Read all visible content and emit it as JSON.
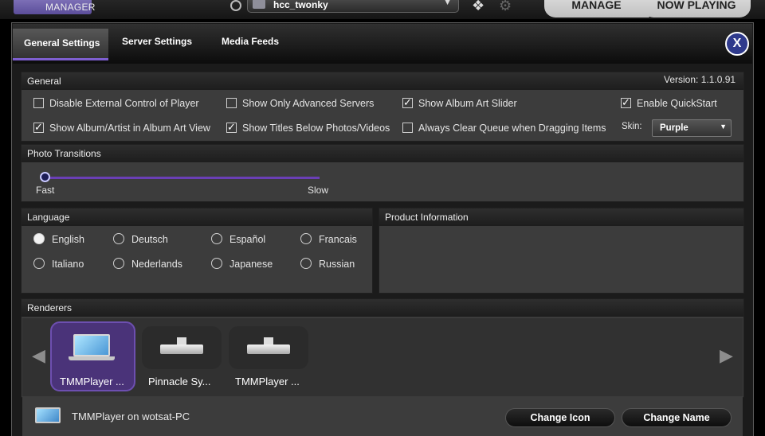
{
  "topbar": {
    "logo_text": "MANAGER",
    "server_name": "hcc_twonky",
    "nav": [
      "MANAGE",
      "NOW PLAYING"
    ]
  },
  "tabs": [
    "General Settings",
    "Server Settings",
    "Media Feeds"
  ],
  "close_label": "X",
  "general": {
    "title": "General",
    "version": "Version: 1.1.0.91",
    "options": [
      {
        "label": "Disable External Control of Player",
        "checked": false
      },
      {
        "label": "Show Only Advanced Servers",
        "checked": false
      },
      {
        "label": "Show Album Art Slider",
        "checked": true
      },
      {
        "label": "Enable QuickStart",
        "checked": true
      },
      {
        "label": "Show Album/Artist in Album Art View",
        "checked": true
      },
      {
        "label": "Show Titles Below Photos/Videos",
        "checked": true
      },
      {
        "label": "Always Clear Queue when Dragging Items",
        "checked": false
      }
    ],
    "skin_label": "Skin:",
    "skin_value": "Purple"
  },
  "photo_transitions": {
    "title": "Photo Transitions",
    "min_label": "Fast",
    "max_label": "Slow",
    "value_fraction": 0.0
  },
  "language": {
    "title": "Language",
    "options": [
      "English",
      "Deutsch",
      "Español",
      "Francais",
      "Italiano",
      "Nederlands",
      "Japanese",
      "Russian"
    ],
    "selected": "English"
  },
  "product_info": {
    "title": "Product Information"
  },
  "renderers": {
    "title": "Renderers",
    "items": [
      {
        "label": "TMMPlayer ...",
        "icon": "laptop-icon",
        "selected": true
      },
      {
        "label": "Pinnacle Sy...",
        "icon": "media-box-icon",
        "selected": false
      },
      {
        "label": "TMMPlayer ...",
        "icon": "media-box-icon",
        "selected": false
      }
    ],
    "current_name": "TMMPlayer on wotsat-PC",
    "change_icon": "Change Icon",
    "change_name": "Change Name"
  }
}
